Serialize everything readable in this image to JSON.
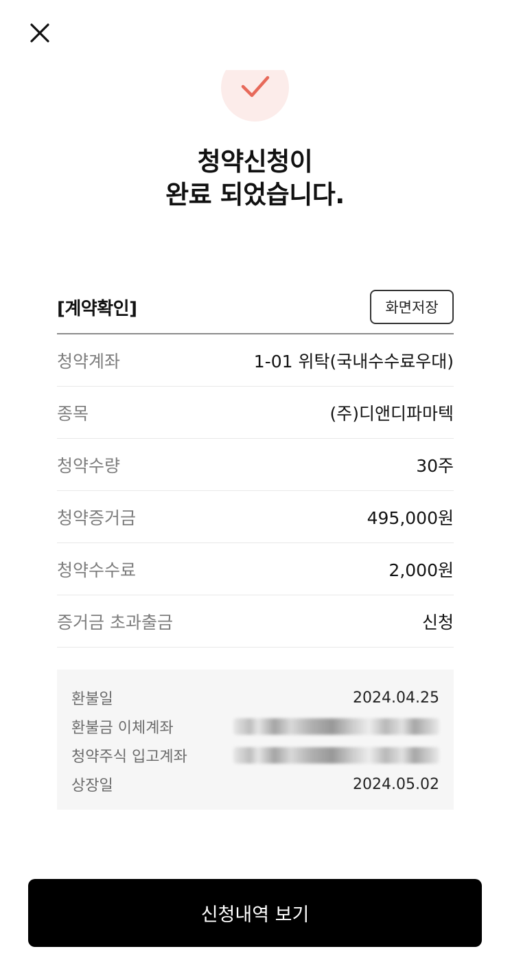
{
  "header": {
    "close_icon": "close-icon"
  },
  "status": {
    "icon": "check-icon",
    "accent_color": "#e7695a",
    "headline_line1": "청약신청이",
    "headline_line2": "완료 되었습니다."
  },
  "contract": {
    "title": "[계약확인]",
    "save_label": "화면저장",
    "rows": [
      {
        "label": "청약계좌",
        "value": "1-01 위탁(국내수수료우대)"
      },
      {
        "label": "종목",
        "value": "(주)디앤디파마텍"
      },
      {
        "label": "청약수량",
        "value": "30주"
      },
      {
        "label": "청약증거금",
        "value": "495,000원"
      },
      {
        "label": "청약수수료",
        "value": "2,000원"
      },
      {
        "label": "증거금 초과출금",
        "value": "신청"
      }
    ]
  },
  "details": {
    "rows": [
      {
        "label": "환불일",
        "value": "2024.04.25"
      },
      {
        "label": "환불금 이체계좌",
        "value": ""
      },
      {
        "label": "청약주식 입고계좌",
        "value": ""
      },
      {
        "label": "상장일",
        "value": "2024.05.02"
      }
    ]
  },
  "cta": {
    "label": "신청내역 보기"
  }
}
